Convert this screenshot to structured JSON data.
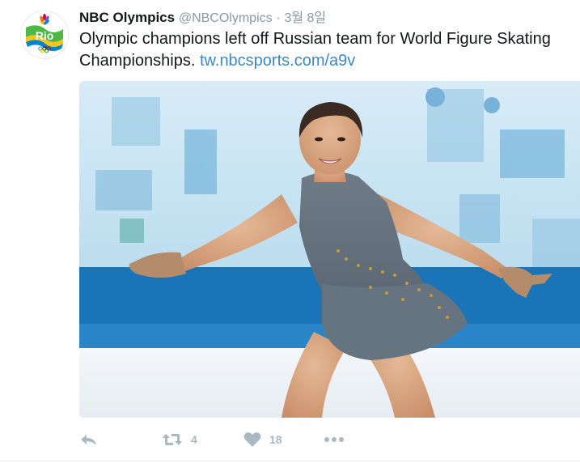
{
  "tweet": {
    "author_name": "NBC Olympics",
    "author_handle": "@NBCOlympics",
    "separator": "·",
    "timestamp": "3월 8일",
    "text": "Olympic champions left off Russian team for World Figure Skating Championships.",
    "link_text": "tw.nbcsports.com/a9v"
  },
  "avatar": {
    "logo_text": "Rio"
  },
  "actions": {
    "reply_icon": "reply-icon",
    "retweet_icon": "retweet-icon",
    "retweet_count": "4",
    "like_icon": "heart-icon",
    "like_count": "18",
    "more_icon": "more-icon"
  },
  "colors": {
    "name": "#14171a",
    "meta": "#8899a6",
    "link": "#3b88c3",
    "action": "#aab8c2",
    "avatar_green": "#4db848",
    "avatar_yellow": "#f7c61b",
    "avatar_blue": "#0083c9"
  }
}
